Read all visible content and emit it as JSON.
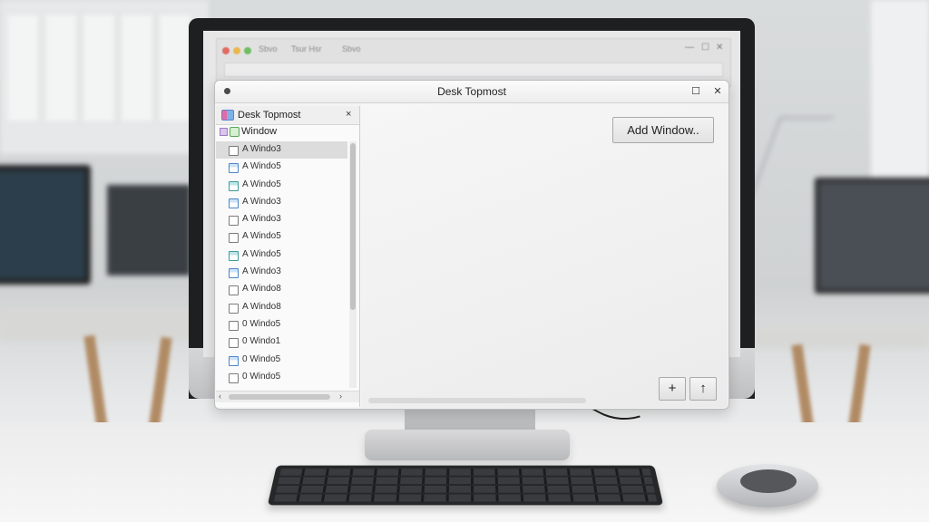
{
  "window": {
    "title": "Desk Topmost",
    "maximize_glyph": "☐",
    "close_glyph": "✕"
  },
  "background_browser": {
    "tabs": [
      "Sbvo",
      "Tsur Hsr",
      "Sbvo"
    ]
  },
  "sidebar": {
    "header": {
      "label": "Desk Topmost",
      "close_glyph": "×"
    },
    "group": {
      "label": "Window"
    },
    "items": [
      {
        "label": "A Windo3",
        "icon": "window-icon",
        "selected": true
      },
      {
        "label": "A Windo5",
        "icon": "window-blue-icon"
      },
      {
        "label": "A Windo5",
        "icon": "window-teal-icon"
      },
      {
        "label": "A Windo3",
        "icon": "window-blue-icon"
      },
      {
        "label": "A Windo3",
        "icon": "window-icon"
      },
      {
        "label": "A Windo5",
        "icon": "window-icon"
      },
      {
        "label": "A Windo5",
        "icon": "window-teal-icon"
      },
      {
        "label": "A Windo3",
        "icon": "window-blue-icon"
      },
      {
        "label": "A Windo8",
        "icon": "window-icon"
      },
      {
        "label": "A Windo8",
        "icon": "window-icon"
      },
      {
        "label": "0 Windo5",
        "icon": "window-icon"
      },
      {
        "label": "0 Windo1",
        "icon": "window-icon"
      },
      {
        "label": "0 Windo5",
        "icon": "window-blue-icon"
      },
      {
        "label": "0 Windo5",
        "icon": "window-icon"
      },
      {
        "label": "0 Windo5",
        "icon": "window-icon"
      }
    ],
    "hscroll_left_glyph": "‹",
    "hscroll_right_glyph": "›"
  },
  "main": {
    "add_window_label": "Add Window..",
    "add_glyph": "+",
    "up_glyph": "↑"
  },
  "colors": {
    "window_bg": "#f4f4f4",
    "selection": "#dcdcdc",
    "border": "#a9a9a9"
  }
}
